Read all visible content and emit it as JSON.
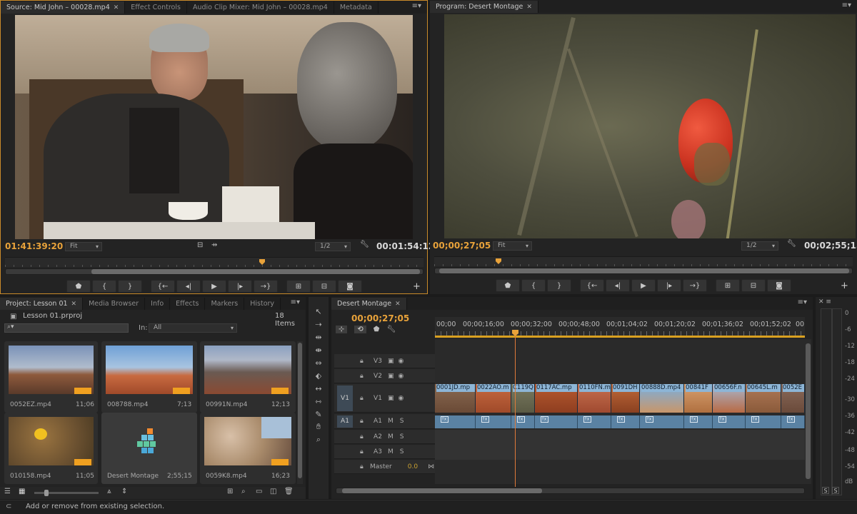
{
  "source_monitor": {
    "tabs": [
      "Source: Mid John – 00028.mp4",
      "Effect Controls",
      "Audio Clip Mixer: Mid John – 00028.mp4",
      "Metadata"
    ],
    "timecode_in": "01:41:39:20",
    "fit": "Fit",
    "resolution": "1/2",
    "duration": "00:01:54:12",
    "icon_names": [
      "marker-icon",
      "mark-in-icon",
      "mark-out-icon",
      "go-to-in-icon",
      "step-back-icon",
      "play-icon",
      "step-forward-icon",
      "go-to-out-icon",
      "insert-icon",
      "overwrite-icon",
      "export-frame-icon",
      "add-button-icon"
    ]
  },
  "program_monitor": {
    "tab": "Program: Desert Montage",
    "timecode": "00;00;27;05",
    "fit": "Fit",
    "resolution": "1/2",
    "duration": "00;02;55;15",
    "icon_names": [
      "marker-icon",
      "mark-in-icon",
      "mark-out-icon",
      "go-to-in-icon",
      "step-back-icon",
      "play-icon",
      "step-forward-icon",
      "go-to-out-icon",
      "lift-icon",
      "extract-icon",
      "export-frame-icon",
      "add-button-icon"
    ]
  },
  "project": {
    "tabs": [
      "Project: Lesson 01",
      "Media Browser",
      "Info",
      "Effects",
      "Markers",
      "History"
    ],
    "filename": "Lesson 01.prproj",
    "items": "18 Items",
    "search_placeholder": "",
    "in_label": "In:",
    "in_value": "All",
    "thumbnails": [
      {
        "name": "0052EZ.mp4",
        "duration": "11;06"
      },
      {
        "name": "008788.mp4",
        "duration": "7;13"
      },
      {
        "name": "00991N.mp4",
        "duration": "12;13"
      },
      {
        "name": "010158.mp4",
        "duration": "11;05"
      },
      {
        "name": "Desert Montage",
        "duration": "2;55;15"
      },
      {
        "name": "0059K8.mp4",
        "duration": "16;23"
      }
    ]
  },
  "timeline": {
    "tab": "Desert Montage",
    "timecode": "00;00;27;05",
    "ruler_ticks": [
      "00;00",
      "00;00;16;00",
      "00;00;32;00",
      "00;00;48;00",
      "00;01;04;02",
      "00;01;20;02",
      "00;01;36;02",
      "00;01;52;02",
      "00"
    ],
    "video_tracks": [
      "V3",
      "V2",
      "V1"
    ],
    "source_v1": "V1",
    "source_a1": "A1",
    "audio_tracks": [
      "A1",
      "A2",
      "A3"
    ],
    "m_label": "M",
    "s_label": "S",
    "master_label": "Master",
    "master_value": "0.0",
    "clips": [
      "0001JD.mp",
      "0022AO.m",
      "C119Q",
      "0117AC.mp",
      "0110FN.m",
      "0091DH",
      "00888D.mp4",
      "00841F",
      "00656F.n",
      "00645L.m",
      "0052E"
    ]
  },
  "meter": {
    "scale": [
      "0",
      "-6",
      "-12",
      "-18",
      "-24",
      "-30",
      "-36",
      "-42",
      "-48",
      "-54",
      "dB"
    ],
    "solo_labels": [
      "S",
      "S"
    ]
  },
  "status_bar": {
    "text": "Add or remove from existing selection."
  },
  "colors": {
    "timecode_orange": "#e8a23a",
    "clip_blue": "#8db5d6",
    "audio_clip_blue": "#5a82a3",
    "playhead": "#e07a3a"
  }
}
